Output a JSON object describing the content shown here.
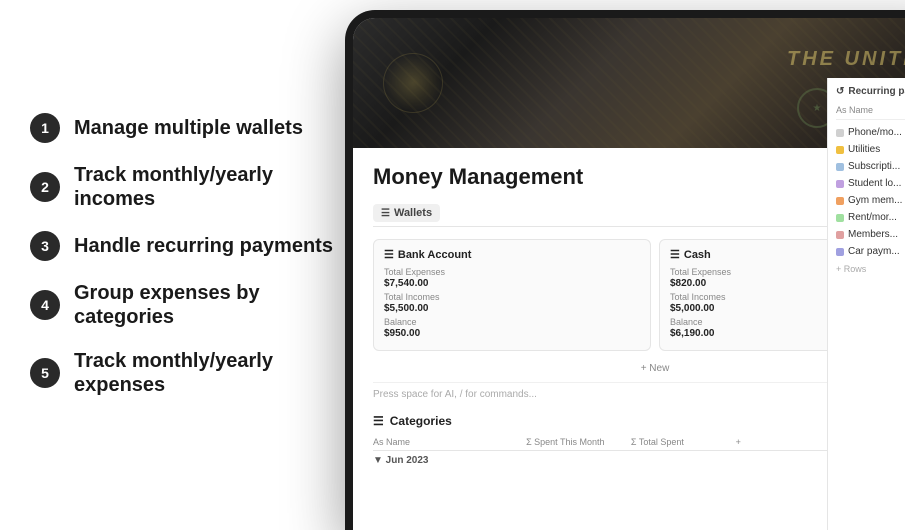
{
  "left": {
    "features": [
      {
        "number": "1",
        "text": "Manage multiple wallets"
      },
      {
        "number": "2",
        "text": "Track monthly/yearly incomes"
      },
      {
        "number": "3",
        "text": "Handle recurring payments"
      },
      {
        "number": "4",
        "text": "Group expenses by categories"
      },
      {
        "number": "5",
        "text": "Track monthly/yearly expenses"
      }
    ]
  },
  "app": {
    "title": "Money Management",
    "tabs": [
      {
        "icon": "☰",
        "label": "Wallets",
        "active": true
      },
      {
        "icon": "↺",
        "label": "Recurring pay..."
      }
    ],
    "wallets": [
      {
        "name": "Bank Account",
        "totalExpensesLabel": "Total Expenses",
        "totalExpenses": "$7,540.00",
        "totalIncomesLabel": "Total Incomes",
        "totalIncomes": "$5,500.00",
        "balanceLabel": "Balance",
        "balance": "$950.00"
      },
      {
        "name": "Cash",
        "totalExpensesLabel": "Total Expenses",
        "totalExpenses": "$820.00",
        "totalIncomesLabel": "Total Incomes",
        "totalIncomes": "$5,000.00",
        "balanceLabel": "Balance",
        "balance": "$6,190.00"
      }
    ],
    "addNewLabel": "+ New",
    "commandHint": "Press space for AI, / for commands...",
    "categoriesSection": {
      "icon": "☰",
      "label": "Categories",
      "columns": [
        "As Name",
        "Σ Spent This Month",
        "Σ Total Spent",
        "+",
        "..."
      ]
    },
    "recurringPanel": {
      "icon": "↺",
      "title": "Recurring pay...",
      "columnLabel": "As Name",
      "items": [
        {
          "icon": "📱",
          "label": "Phone/mo...",
          "color": "#d0d0d0"
        },
        {
          "icon": "⚡",
          "label": "Utilities",
          "color": "#f0c040"
        },
        {
          "icon": "🎵",
          "label": "Subscripti...",
          "color": "#a0c0e0"
        },
        {
          "icon": "🎓",
          "label": "Student lo...",
          "color": "#c0a0e0"
        },
        {
          "icon": "🏋",
          "label": "Gym mem...",
          "color": "#f0a060"
        },
        {
          "icon": "🏠",
          "label": "Rent/mor...",
          "color": "#a0e0a0"
        },
        {
          "icon": "👥",
          "label": "Members...",
          "color": "#e0a0a0"
        },
        {
          "icon": "🚗",
          "label": "Car paym...",
          "color": "#a0a0e0"
        }
      ],
      "addRowsLabel": "+ Rows"
    },
    "monthTag": "▼ Jun 2023"
  }
}
